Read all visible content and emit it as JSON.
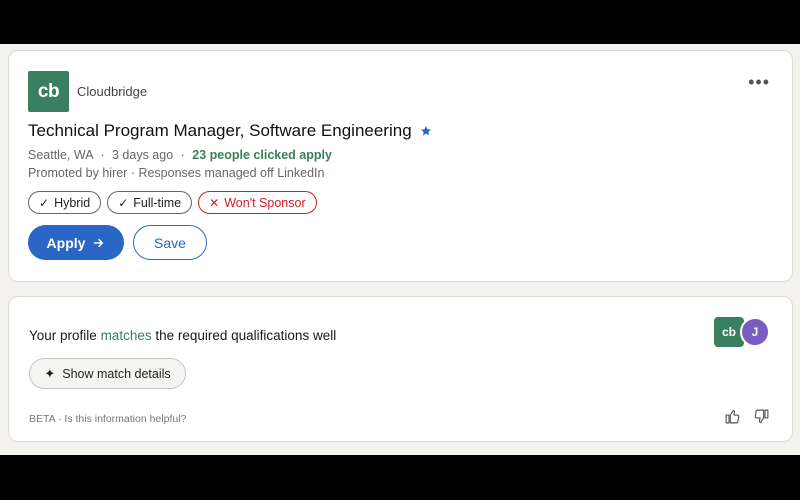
{
  "job": {
    "logo_text": "cb",
    "company": "Cloudbridge",
    "more_label": "•••",
    "title": "Technical Program Manager, Software Engineering",
    "location": "Seattle, WA",
    "posted": "3 days ago",
    "sep": "·",
    "applied": "23 people clicked apply",
    "promoted": "Promoted by hirer · Responses managed off LinkedIn",
    "pills": [
      {
        "icon": "✓",
        "label": "Hybrid"
      },
      {
        "icon": "✓",
        "label": "Full-time"
      },
      {
        "icon": "✕",
        "label": "Won't Sponsor"
      }
    ],
    "apply_label": "Apply",
    "save_label": "Save"
  },
  "match": {
    "text_before": "Your profile ",
    "text_highlight": "matches",
    "text_after": " the required qualifications well",
    "avatar_company": "cb",
    "avatar_user": "J",
    "show_details_label": "Show match details",
    "beta_text": "BETA · Is this information helpful?"
  },
  "colors": {
    "brand_green": "#3a7f5f",
    "primary_blue": "#2a66c6",
    "warning_red": "#cc1f1f",
    "avatar_purple": "#7a5cc4"
  }
}
